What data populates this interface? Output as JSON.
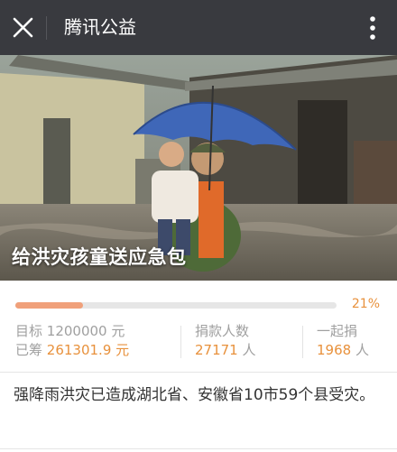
{
  "header": {
    "close_icon": "close-icon",
    "title": "腾讯公益",
    "more_icon": "more-vertical-icon"
  },
  "hero": {
    "caption": "给洪灾孩童送应急包"
  },
  "progress": {
    "fraction": 0.21,
    "percent_label": "21%"
  },
  "stats": {
    "target_label": "目标",
    "target_value": "1200000",
    "target_unit": "元",
    "raised_label": "已筹",
    "raised_value": "261301.9",
    "raised_unit": "元",
    "donors_label": "捐款人数",
    "donors_value": "27171",
    "donors_unit": "人",
    "together_label": "一起捐",
    "together_value": "1968",
    "together_unit": "人"
  },
  "description": "强降雨洪灾已造成湖北省、安徽省10市59个县受灾。",
  "colors": {
    "topbar": "#393a3f",
    "accent": "#e8913c",
    "progress_fill": "#f0a07a"
  }
}
